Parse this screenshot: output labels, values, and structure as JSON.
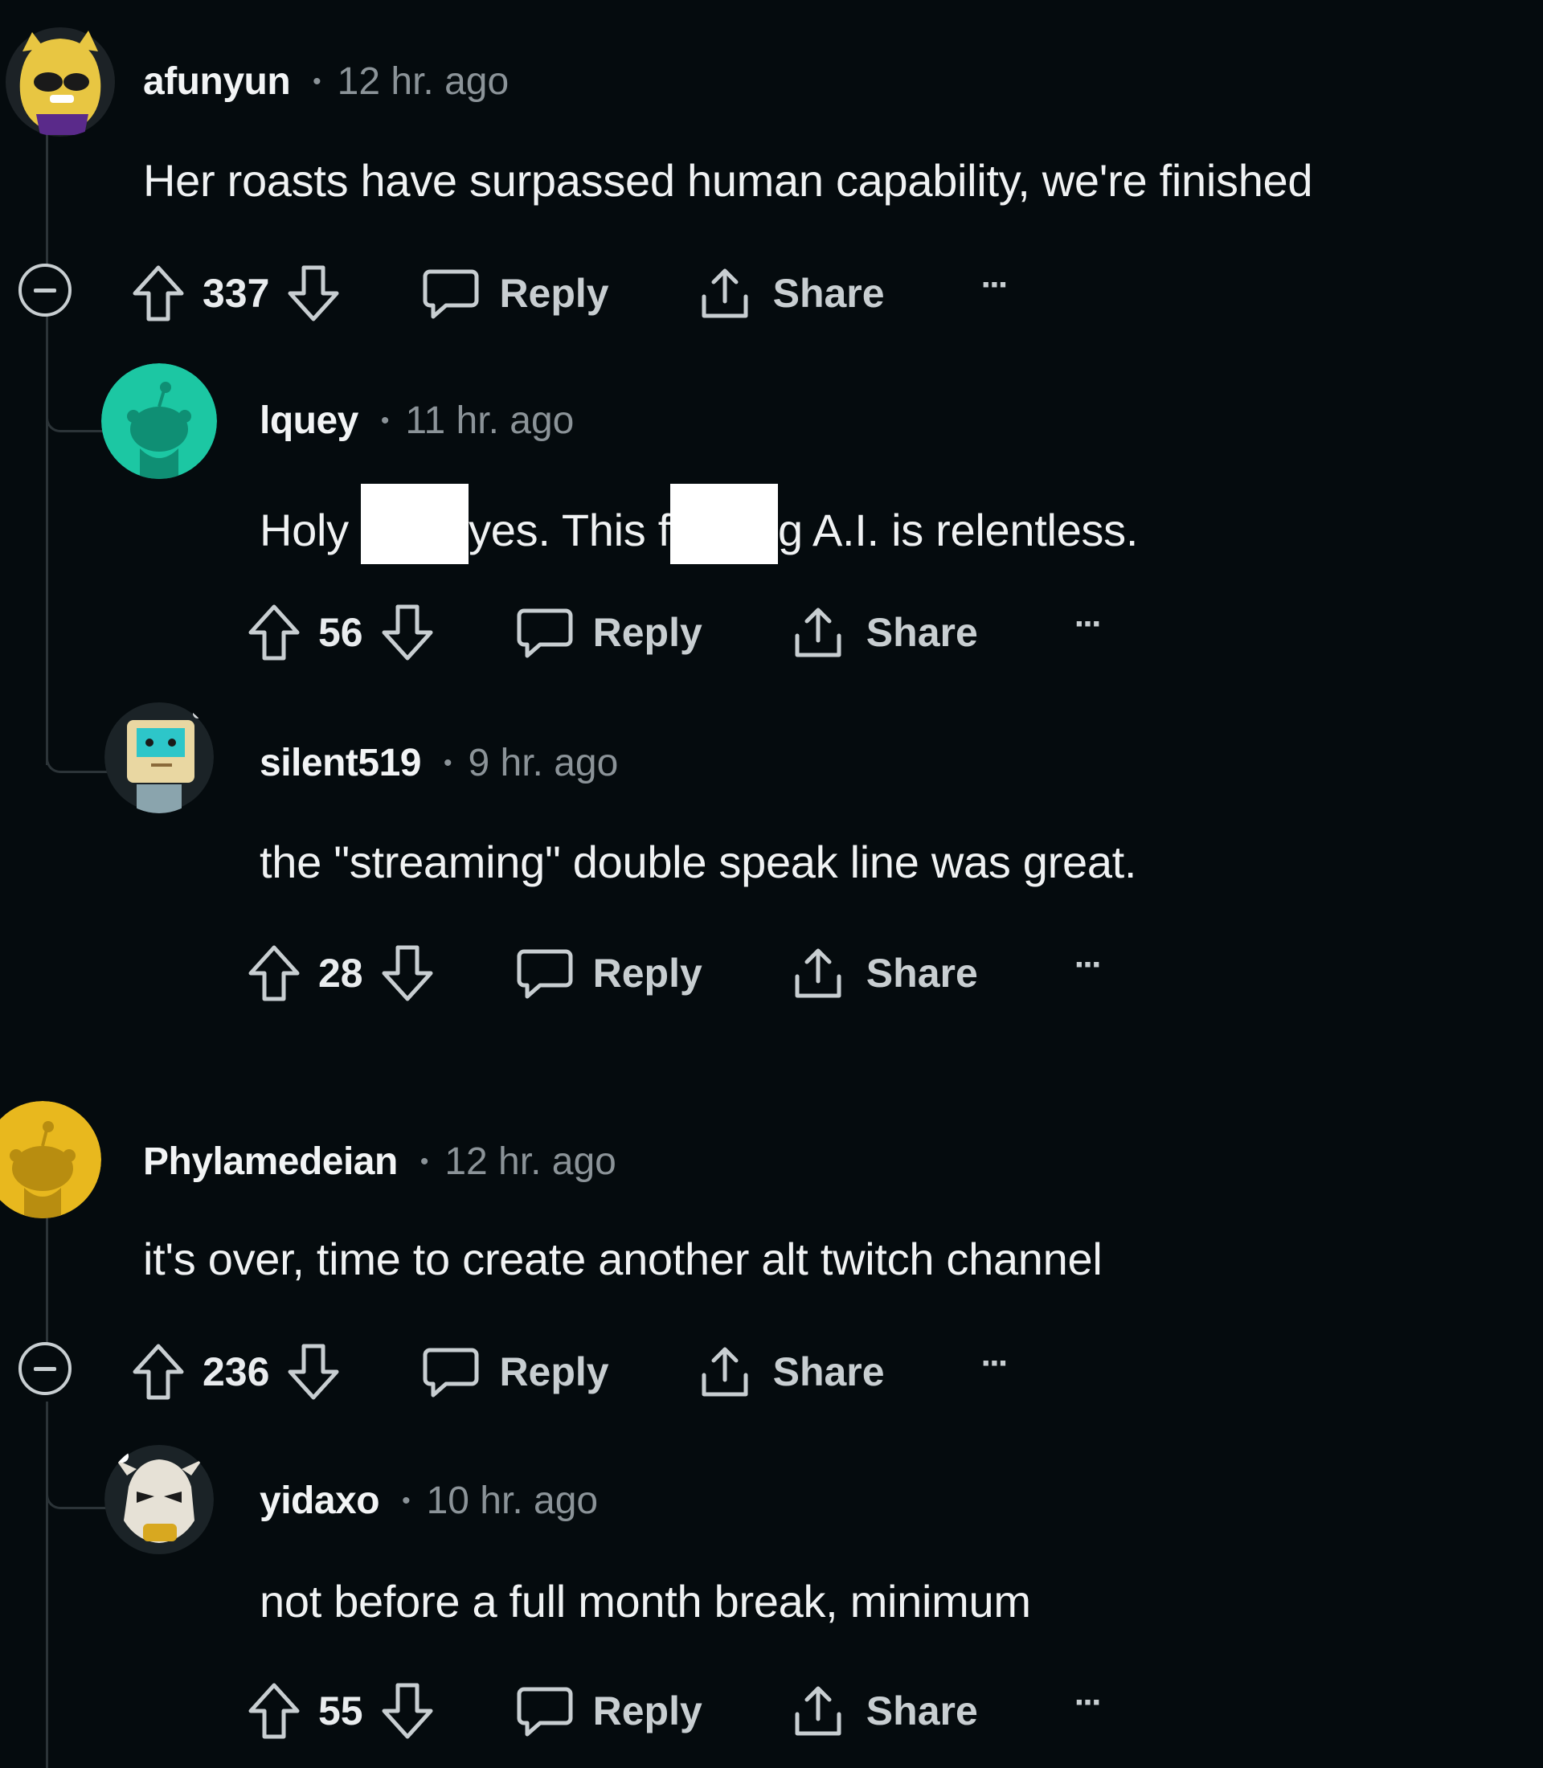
{
  "comments": [
    {
      "username": "afunyun",
      "time": "12 hr. ago",
      "text": "Her roasts have surpassed human capability, we're finished",
      "votes": "337",
      "reply_label": "Reply",
      "share_label": "Share",
      "more_label": "···"
    },
    {
      "username": "lquey",
      "time": "11 hr. ago",
      "text_a": "Holy ",
      "text_b": "yes. This f",
      "text_c": "g A.I. is relentless.",
      "votes": "56",
      "reply_label": "Reply",
      "share_label": "Share",
      "more_label": "···"
    },
    {
      "username": "silent519",
      "time": "9 hr. ago",
      "text": "the \"streaming\" double speak line was great.",
      "votes": "28",
      "reply_label": "Reply",
      "share_label": "Share",
      "more_label": "···"
    },
    {
      "username": "Phylamedeian",
      "time": "12 hr. ago",
      "text": "it's over, time to create another alt twitch channel",
      "votes": "236",
      "reply_label": "Reply",
      "share_label": "Share",
      "more_label": "···"
    },
    {
      "username": "yidaxo",
      "time": "10 hr. ago",
      "text": "not before a full month break, minimum",
      "votes": "55",
      "reply_label": "Reply",
      "share_label": "Share",
      "more_label": "···"
    }
  ],
  "meta_dot": "•",
  "colors": {
    "background": "#050b0e",
    "thread_line": "#2c3438",
    "avatar_lquey": "#1cc7a3",
    "avatar_phylamedeian": "#e8b81e"
  }
}
